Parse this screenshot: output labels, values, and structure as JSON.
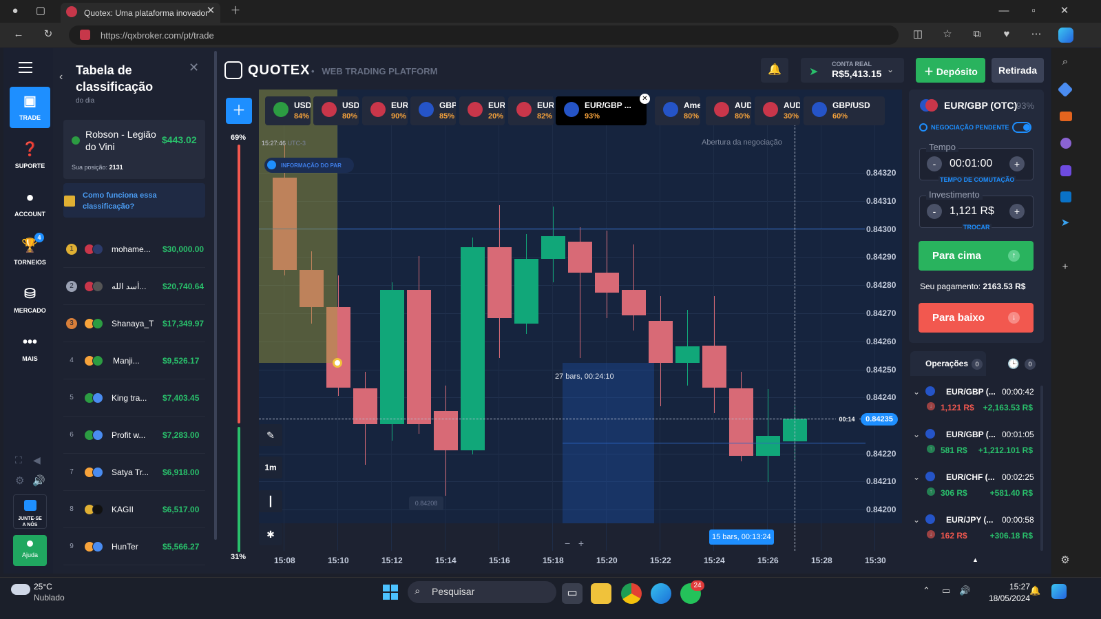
{
  "browser": {
    "tab_title": "Quotex: Uma plataforma inovador",
    "url": "https://qxbroker.com/pt/trade"
  },
  "header": {
    "logo": "QUOTEX",
    "subtitle": "WEB TRADING PLATFORM",
    "account_label": "CONTA REAL",
    "balance": "R$5,413.15",
    "deposit_label": "Depósito",
    "withdraw_label": "Retirada"
  },
  "nav": [
    {
      "label": "TRADE",
      "icon": "chart-icon"
    },
    {
      "label": "SUPORTE",
      "icon": "help-icon"
    },
    {
      "label": "ACCOUNT",
      "icon": "user-icon"
    },
    {
      "label": "TORNEIOS",
      "icon": "trophy-icon",
      "badge": "4"
    },
    {
      "label": "MERCADO",
      "icon": "market-icon"
    },
    {
      "label": "MAIS",
      "icon": "more-icon"
    }
  ],
  "join": {
    "label_1": "JUNTE-SE",
    "label_2": "A NÓS"
  },
  "help_label": "Ajuda",
  "leaderboard": {
    "title_1": "Tabela de",
    "title_2": "classificação",
    "subtitle": "do dia",
    "me_name_1": "Robson - Legião",
    "me_name_2": "do Vini",
    "me_amount": "$443.02",
    "position_label": "Sua posição:",
    "position": "2131",
    "how_1": "Como funciona essa",
    "how_2": "classificação?",
    "rows": [
      {
        "rank": "1",
        "name": "mohame...",
        "amount": "$30,000.00"
      },
      {
        "rank": "2",
        "name": "أسد الله...",
        "amount": "$20,740.64"
      },
      {
        "rank": "3",
        "name": "Shanaya_T",
        "amount": "$17,349.97"
      },
      {
        "rank": "4",
        "name": "Manji...",
        "amount": "$9,526.17"
      },
      {
        "rank": "5",
        "name": "King tra...",
        "amount": "$7,403.45"
      },
      {
        "rank": "6",
        "name": "Profit w...",
        "amount": "$7,283.00"
      },
      {
        "rank": "7",
        "name": "Satya Tr...",
        "amount": "$6,918.00"
      },
      {
        "rank": "8",
        "name": "KAGII",
        "amount": "$6,517.00"
      },
      {
        "rank": "9",
        "name": "HunTer",
        "amount": "$5,566.27"
      }
    ]
  },
  "sentiment": {
    "up": "69%",
    "down": "31%"
  },
  "pairs": [
    {
      "name": "USD/",
      "pct": "84%"
    },
    {
      "name": "USD/(",
      "pct": "80%"
    },
    {
      "name": "EUR/J",
      "pct": "90%"
    },
    {
      "name": "GBP/A",
      "pct": "85%"
    },
    {
      "name": "EUR/(",
      "pct": "20%"
    },
    {
      "name": "EUR/(",
      "pct": "82%"
    },
    {
      "name": "EUR/GBP ...",
      "pct": "93%",
      "active": true
    },
    {
      "name": "Ameri",
      "pct": "80%"
    },
    {
      "name": "AUD/(",
      "pct": "80%"
    },
    {
      "name": "AUD/(",
      "pct": "30%"
    },
    {
      "name": "GBP/USD",
      "pct": "60%"
    }
  ],
  "chart": {
    "clock": "15:27:46",
    "tz": "UTC-3",
    "info_label": "INFORMAÇÃO DO PAR",
    "open_label": "Abertura da negociação",
    "bars_label_1": "27 bars, 00:24:10",
    "bars_label_2": "15 bars, 00:13:24",
    "low_tag": "0.84208",
    "countdown": "00:14",
    "current_price": "0.84235",
    "timeframe": "1m",
    "price_labels": [
      "0.84320",
      "0.84310",
      "0.84300",
      "0.84290",
      "0.84280",
      "0.84270",
      "0.84260",
      "0.84250",
      "0.84240",
      "0.84220",
      "0.84210",
      "0.84200"
    ],
    "time_labels": [
      "15:08",
      "15:10",
      "15:12",
      "15:14",
      "15:16",
      "15:18",
      "15:20",
      "15:22",
      "15:24",
      "15:26",
      "15:28",
      "15:30"
    ]
  },
  "trade": {
    "pair": "EUR/GBP (OTC)",
    "payout": "93%",
    "pending_label": "NEGOCIAÇÃO PENDENTE",
    "time_label": "Tempo",
    "time_value": "00:01:00",
    "time_hint": "TEMPO DE COMUTAÇÃO",
    "invest_label": "Investimento",
    "invest_value": "1,121 R$",
    "invest_hint": "TROCAR",
    "up_label": "Para cima",
    "payment_label": "Seu pagamento:",
    "payment_value": "2163.53 R$",
    "down_label": "Para baixo"
  },
  "operations": {
    "label": "Operações",
    "count": "0",
    "pending_count": "0",
    "items": [
      {
        "pair": "EUR/GBP (...",
        "time": "00:00:42",
        "stake": "1,121 R$",
        "profit": "+2,163.53 R$",
        "dir": "down"
      },
      {
        "pair": "EUR/GBP (...",
        "time": "00:01:05",
        "stake": "581 R$",
        "profit": "+1,212.101 R$",
        "dir": "up"
      },
      {
        "pair": "EUR/CHF (...",
        "time": "00:02:25",
        "stake": "306 R$",
        "profit": "+581.40 R$",
        "dir": "up"
      },
      {
        "pair": "EUR/JPY (...",
        "time": "00:00:58",
        "stake": "162 R$",
        "profit": "+306.18 R$",
        "dir": "down"
      }
    ]
  },
  "taskbar": {
    "temp": "25°C",
    "weather": "Nublado",
    "search": "Pesquisar",
    "time": "15:27",
    "date": "18/05/2024",
    "whatsapp_badge": "24"
  },
  "colors": {
    "up": "#11a779",
    "down": "#d86a76",
    "accent_green": "#29c06b",
    "accent_red": "#f2584f",
    "blue": "#1e8fff"
  }
}
